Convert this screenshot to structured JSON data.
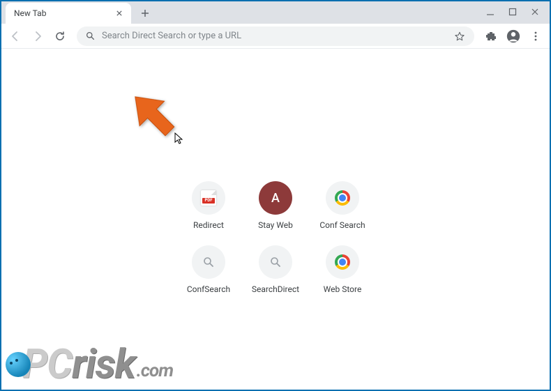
{
  "window": {
    "tab_title": "New Tab"
  },
  "omnibox": {
    "placeholder": "Search Direct Search or type a URL"
  },
  "shortcuts": [
    {
      "label": "Redirect",
      "icon": "pdf"
    },
    {
      "label": "Stay Web",
      "icon": "avatar",
      "avatar_letter": "A"
    },
    {
      "label": "Conf Search",
      "icon": "chrome"
    },
    {
      "label": "ConfSearch",
      "icon": "search"
    },
    {
      "label": "SearchDirect",
      "icon": "search"
    },
    {
      "label": "Web Store",
      "icon": "chrome"
    }
  ],
  "watermark": {
    "pc": "PC",
    "risk": "risk",
    "com": ".com"
  },
  "pdf_badge": "PDF"
}
